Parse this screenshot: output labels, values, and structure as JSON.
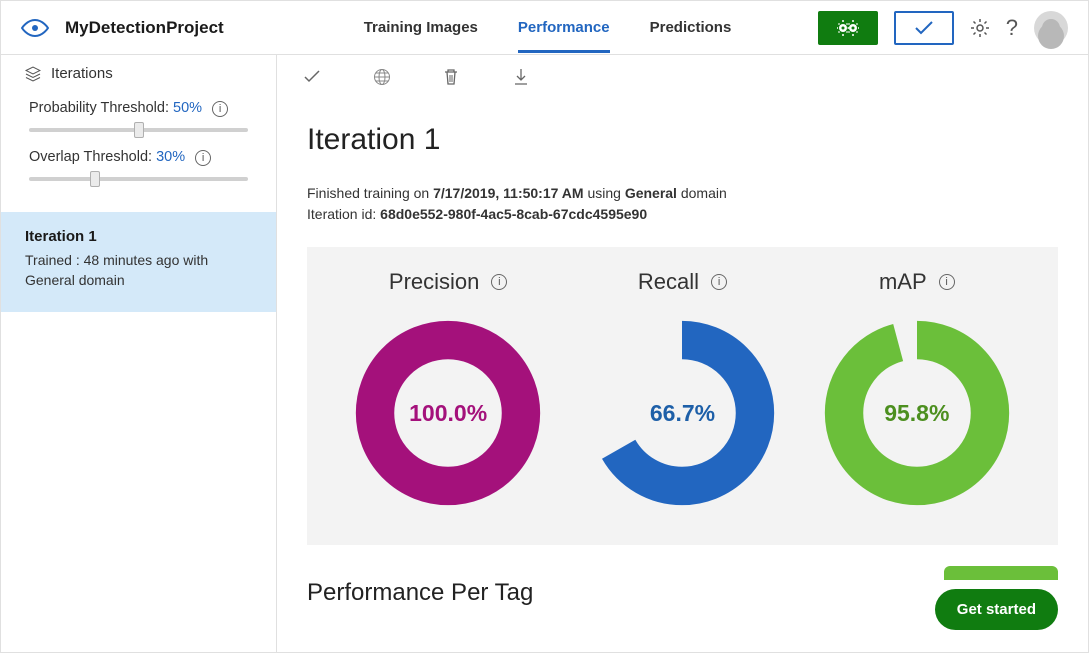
{
  "header": {
    "project": "MyDetectionProject",
    "tabs": [
      "Training Images",
      "Performance",
      "Predictions"
    ],
    "active_tab_index": 1
  },
  "sidebar": {
    "iterations_label": "Iterations",
    "prob_threshold": {
      "label": "Probability Threshold:",
      "value": "50%",
      "pct": 50
    },
    "overlap_threshold": {
      "label": "Overlap Threshold:",
      "value": "30%",
      "pct": 30
    },
    "selected_iteration": {
      "title": "Iteration 1",
      "subtitle": "Trained : 48 minutes ago with General domain"
    }
  },
  "main": {
    "heading": "Iteration 1",
    "finished_prefix": "Finished training on ",
    "finished_datetime": "7/17/2019, 11:50:17 AM",
    "finished_mid": " using ",
    "finished_domain": "General",
    "finished_suffix": " domain",
    "iterid_label": "Iteration id: ",
    "iterid_value": "68d0e552-980f-4ac5-8cab-67cdc4595e90",
    "metrics": {
      "precision": {
        "label": "Precision",
        "value_text": "100.0%"
      },
      "recall": {
        "label": "Recall",
        "value_text": "66.7%"
      },
      "map": {
        "label": "mAP",
        "value_text": "95.8%"
      }
    },
    "perf_per_tag_heading": "Performance Per Tag",
    "get_started_label": "Get started"
  },
  "colors": {
    "precision": "#a4117b",
    "recall": "#2266c0",
    "map": "#6bbf3a",
    "metric_track": "#f3f3f3"
  },
  "chart_data": [
    {
      "type": "pie",
      "title": "Precision",
      "series": [
        {
          "name": "Precision",
          "values": [
            100.0
          ]
        }
      ],
      "ylim": [
        0,
        100
      ]
    },
    {
      "type": "pie",
      "title": "Recall",
      "series": [
        {
          "name": "Recall",
          "values": [
            66.7
          ]
        }
      ],
      "ylim": [
        0,
        100
      ]
    },
    {
      "type": "pie",
      "title": "mAP",
      "series": [
        {
          "name": "mAP",
          "values": [
            95.8
          ]
        }
      ],
      "ylim": [
        0,
        100
      ]
    }
  ]
}
